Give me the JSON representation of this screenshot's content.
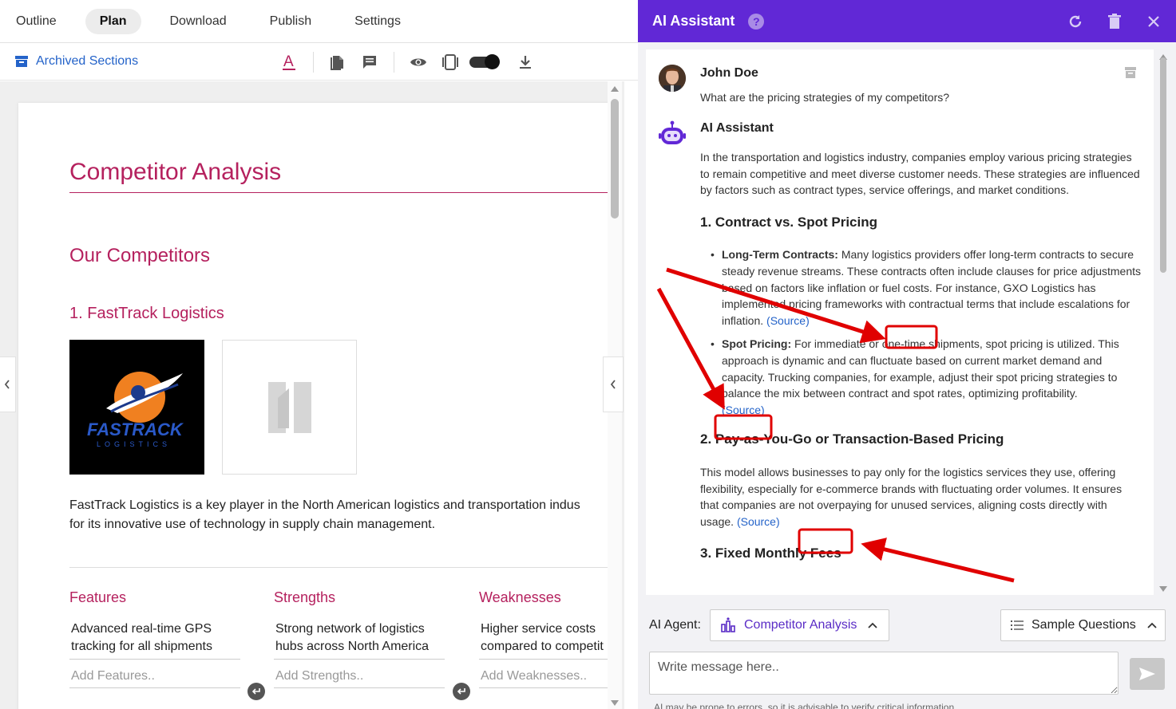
{
  "nav": {
    "tabs": [
      "Outline",
      "Plan",
      "Download",
      "Publish",
      "Settings"
    ],
    "active": "Plan"
  },
  "toolbar": {
    "archived_label": "Archived Sections"
  },
  "document": {
    "title": "Competitor Analysis",
    "section": "Our Competitors",
    "competitor": "1. FastTrack Logistics",
    "logo_text": "FASTRACK",
    "logo_sub": "LOGISTICS",
    "paragraph_line1": "FastTrack Logistics is a key player in the North American logistics and transportation indus",
    "paragraph_line2": "for its innovative use of technology in supply chain management.",
    "columns": [
      {
        "heading": "Features",
        "item_line1": "Advanced real-time GPS",
        "item_line2": "tracking for all shipments",
        "add_placeholder": "Add Features.."
      },
      {
        "heading": "Strengths",
        "item_line1": "Strong network of logistics",
        "item_line2": "hubs across North America",
        "add_placeholder": "Add Strengths.."
      },
      {
        "heading": "Weaknesses",
        "item_line1": "Higher service costs",
        "item_line2": "compared to competit",
        "add_placeholder": "Add Weaknesses.."
      }
    ]
  },
  "assistant": {
    "title": "AI Assistant",
    "help": "?",
    "user_name": "John Doe",
    "user_question": "What are the pricing strategies of my competitors?",
    "bot_name": "AI Assistant",
    "intro": "In the transportation and logistics industry, companies employ various pricing strategies to remain competitive and meet diverse customer needs. These strategies are influenced by factors such as contract types, service offerings, and market conditions.",
    "h1": "1. Contract vs. Spot Pricing",
    "b1_label": "Long-Term Contracts:",
    "b1_text": " Many logistics providers offer long-term contracts to secure steady revenue streams. These contracts often include clauses for price adjustments based on factors like inflation or fuel costs. For instance, GXO Logistics has implemented pricing frameworks with contractual terms that include escalations for inflation. ",
    "b2_label": "Spot Pricing:",
    "b2_text": " For immediate or one-time shipments, spot pricing is utilized. This approach is dynamic and can fluctuate based on current market demand and capacity. Trucking companies, for example, adjust their spot pricing strategies to balance the mix between contract and spot rates, optimizing profitability.",
    "h2": "2. Pay-as-You-Go or Transaction-Based Pricing",
    "p2": "This model allows businesses to pay only for the logistics services they use, offering flexibility, especially for e-commerce brands with fluctuating order volumes. It ensures that companies are not overpaying for unused services, aligning costs directly with usage. ",
    "h3": "3. Fixed Monthly Fees",
    "source_label": "(Source)",
    "agent_label": "AI Agent:",
    "agent_value": "Competitor Analysis",
    "sample_label": "Sample Questions",
    "input_placeholder": "Write message here..",
    "disclaimer": "AI may be prone to errors, so it is advisable to verify critical information."
  },
  "colors": {
    "accent": "#6128d6",
    "heading": "#b5215e",
    "link": "#2463c9",
    "annotation": "#e00000"
  }
}
